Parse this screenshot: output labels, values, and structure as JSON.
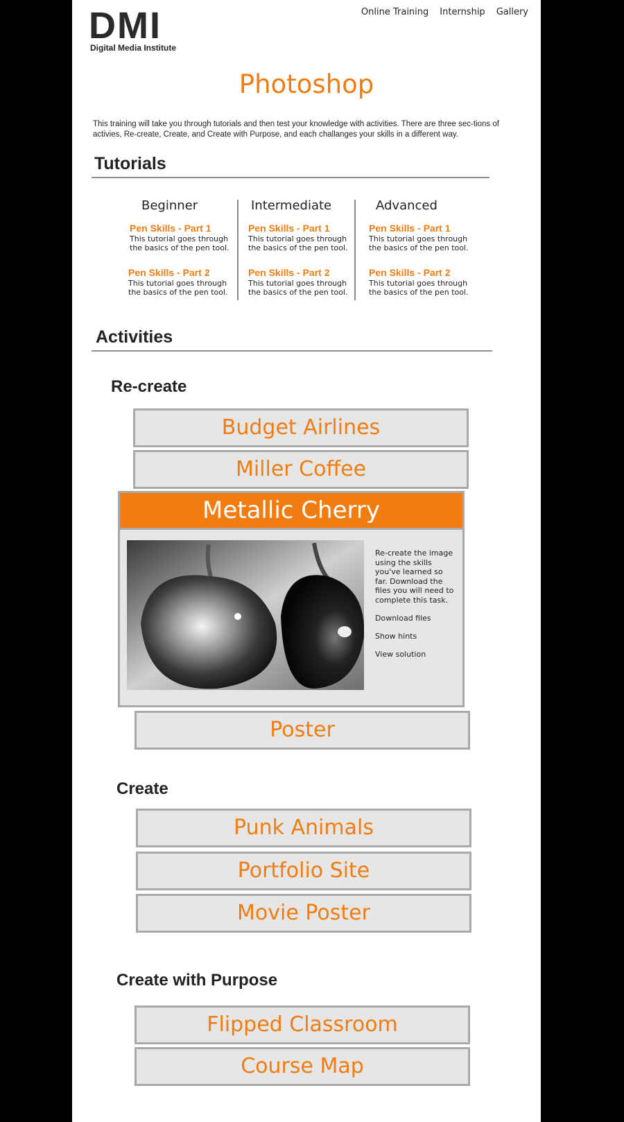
{
  "logo": {
    "letters": "DMI",
    "subtitle": "Digital Media Institute"
  },
  "nav": {
    "items": [
      "Online Training",
      "Internship",
      "Gallery"
    ]
  },
  "page_title": "Photoshop",
  "intro": "This training will take you through tutorials and then test your knowledge with activities. There are three sec-tions of activies, Re-create, Create, and Create with Purpose, and each challanges your skills in a different way.",
  "tutorials": {
    "heading": "Tutorials",
    "columns": [
      {
        "level": "Beginner",
        "items": [
          {
            "title": "Pen Skills - Part 1",
            "desc": "This tutorial goes through the basics of the pen tool."
          },
          {
            "title": "Pen Skills - Part 2",
            "desc": "This tutorial goes through the basics of the pen tool."
          }
        ]
      },
      {
        "level": "Intermediate",
        "items": [
          {
            "title": "Pen Skills - Part 1",
            "desc": "This tutorial goes through the basics of the pen tool."
          },
          {
            "title": "Pen Skills - Part 2",
            "desc": "This tutorial goes through the basics of the pen tool."
          }
        ]
      },
      {
        "level": "Advanced",
        "items": [
          {
            "title": "Pen Skills - Part 1",
            "desc": "This tutorial goes through the basics of the pen tool."
          },
          {
            "title": "Pen Skills - Part 2",
            "desc": "This tutorial goes through the basics of the pen tool."
          }
        ]
      }
    ]
  },
  "activities": {
    "heading": "Activities",
    "recreate": {
      "heading": "Re-create",
      "items": [
        "Budget Airlines",
        "Miller Coffee",
        "Poster"
      ],
      "expanded": {
        "title": "Metallic Cherry",
        "image_alt": "Black and white photo of metallic cherries",
        "description": "Re-create the image using the skills you've learned so far. Download the files you will need to complete this task.",
        "links": [
          "Download files",
          "Show hints",
          "View solution"
        ]
      }
    },
    "create": {
      "heading": "Create",
      "items": [
        "Punk Animals",
        "Portfolio Site",
        "Movie Poster"
      ]
    },
    "purpose": {
      "heading": "Create with Purpose",
      "items": [
        "Flipped Classroom",
        "Course Map"
      ]
    }
  },
  "colors": {
    "accent": "#f07c12",
    "button_bg": "#e6e6e6",
    "button_border": "#a9a9a9",
    "outer_bg": "#000000"
  }
}
